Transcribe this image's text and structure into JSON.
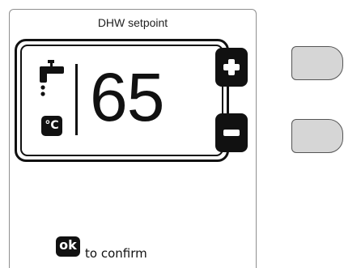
{
  "panel": {
    "title": "DHW setpoint"
  },
  "display": {
    "icon": "tap-icon",
    "unit_label": "°C",
    "value": "65"
  },
  "buttons": {
    "increase_icon": "plus-icon",
    "decrease_icon": "minus-icon"
  },
  "hardware_buttons": [
    "upper-side-key",
    "lower-side-key"
  ],
  "footer": {
    "ok_label": "ok",
    "confirm_text": "to confirm"
  }
}
